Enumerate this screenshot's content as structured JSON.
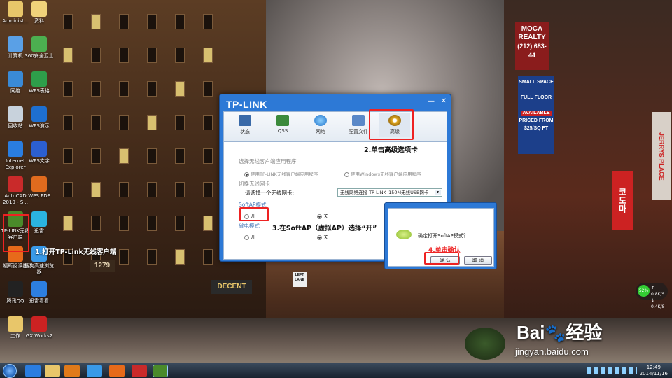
{
  "desktop_icons": [
    {
      "label": "Administ...",
      "color": "#e8c66a"
    },
    {
      "label": "资料",
      "color": "#f0d27a"
    },
    {
      "label": "计算机",
      "color": "#5aa0e6"
    },
    {
      "label": "360安全卫士",
      "color": "#4caf50"
    },
    {
      "label": "网络",
      "color": "#3a8ad6"
    },
    {
      "label": "WPS表格",
      "color": "#2e9e4a"
    },
    {
      "label": "回收站",
      "color": "#c8d2dc"
    },
    {
      "label": "WPS演示",
      "color": "#1e6fd0"
    },
    {
      "label": "Internet Explorer",
      "color": "#2a7de0"
    },
    {
      "label": "WPS文字",
      "color": "#2c5fd0"
    },
    {
      "label": "AutoCAD 2010 - S...",
      "color": "#c92a2a"
    },
    {
      "label": "WPS PDF",
      "color": "#e06b1e"
    },
    {
      "label": "TP-LINK无线客户端",
      "color": "#4a8a2a"
    },
    {
      "label": "迅雷",
      "color": "#2bb4e0"
    },
    {
      "label": "福昕阅读器",
      "color": "#e76a1a"
    },
    {
      "label": "搜狗高速浏览器",
      "color": "#3a9ae8"
    },
    {
      "label": "腾讯QQ",
      "color": "#222222"
    },
    {
      "label": "迅雷看看",
      "color": "#2d7fe0"
    },
    {
      "label": "工作",
      "color": "#e8c66a"
    },
    {
      "label": "GX Works2",
      "color": "#cc2222"
    }
  ],
  "annotations": {
    "step1": "1.打开TP-Link无线客户端",
    "step2": "2.单击高级选项卡",
    "step3": "3.在SoftAP（虚拟AP）选择“开”",
    "step4": "4.单击确认"
  },
  "dialog": {
    "brand": "TP-LINK",
    "minimize": "—",
    "close": "✕",
    "tabs": [
      "状态",
      "QSS",
      "网络",
      "配置文件",
      "高级"
    ],
    "group_client": "选择无线客户端应用程序",
    "opt_tplink": "使用TP-LINK无线客户端应用程序",
    "opt_windows": "使用Windows无线客户端应用程序",
    "group_adapter": "切换无线网卡",
    "adapter_prompt": "请选择一个无线网卡:",
    "adapter_value": "无线网络连接  TP-LINK_150M无线USB网卡",
    "group_softap": "SoftAP模式",
    "softap_on": "开",
    "softap_off": "关",
    "group_power": "省电模式",
    "power_on": "开",
    "power_off": "关"
  },
  "confirm": {
    "message": "确定打开SoftAP模式？",
    "ok": "确 认",
    "cancel": "取 消"
  },
  "network_widget": {
    "pct": "52%",
    "up": "0.8K/S",
    "down": "0.4K/S"
  },
  "watermark": {
    "brand": "Bai",
    "brand2": "经验",
    "url": "jingyan.baidu.com"
  },
  "clock": {
    "time": "12:49",
    "date": "2014/11/16"
  },
  "signs": {
    "moca": "MOCA REALTY",
    "phone": "(212) 683-44",
    "space": "SMALL SPACE",
    "floor": "FULL FLOOR",
    "avail": "AVAILABLE",
    "priced": "PRICED FROM $25/SQ FT",
    "decent": "DECENT",
    "jerry": "JERRYS PLACE",
    "num": "1279",
    "left": "LEFT LANE",
    "kor": "코도마"
  }
}
